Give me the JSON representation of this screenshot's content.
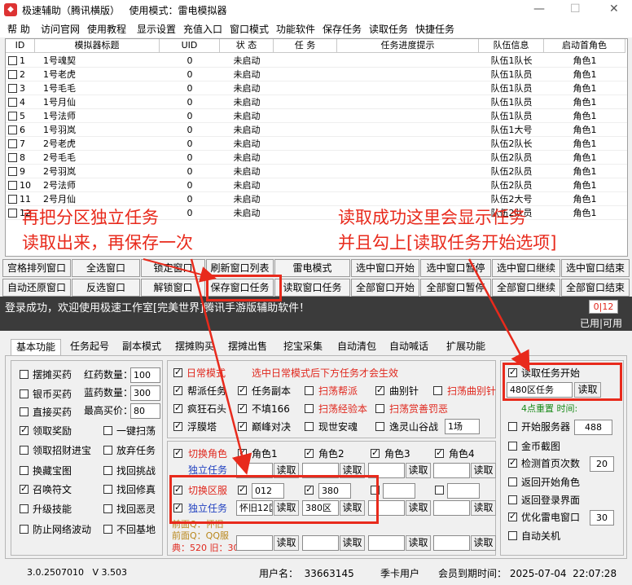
{
  "window": {
    "title": "极速辅助（腾讯横版）   使用模式：雷电模拟器",
    "minimize": "—",
    "maximize": "☐",
    "close": "✕"
  },
  "menu": [
    "帮 助",
    "访问官网",
    "使用教程",
    "显示设置",
    "充值入口",
    "窗口模式",
    "功能软件",
    "保存任务",
    "读取任务",
    "快捷任务"
  ],
  "grid": {
    "headers": [
      "ID",
      "模拟器标题",
      "UID",
      "状 态",
      "任 务",
      "任务进度提示",
      "队伍信息",
      "启动首角色"
    ],
    "rows": [
      {
        "id": "1",
        "title": "1号魂契",
        "uid": "0",
        "status": "未启动",
        "team": "队伍1队长",
        "role": "角色1"
      },
      {
        "id": "2",
        "title": "1号老虎",
        "uid": "0",
        "status": "未启动",
        "team": "队伍1队员",
        "role": "角色1"
      },
      {
        "id": "3",
        "title": "1号毛毛",
        "uid": "0",
        "status": "未启动",
        "team": "队伍1队员",
        "role": "角色1"
      },
      {
        "id": "4",
        "title": "1号月仙",
        "uid": "0",
        "status": "未启动",
        "team": "队伍1队员",
        "role": "角色1"
      },
      {
        "id": "5",
        "title": "1号法师",
        "uid": "0",
        "status": "未启动",
        "team": "队伍1队员",
        "role": "角色1"
      },
      {
        "id": "6",
        "title": "1号羽岚",
        "uid": "0",
        "status": "未启动",
        "team": "队伍1大号",
        "role": "角色1"
      },
      {
        "id": "7",
        "title": "2号老虎",
        "uid": "0",
        "status": "未启动",
        "team": "队伍2队长",
        "role": "角色1"
      },
      {
        "id": "8",
        "title": "2号毛毛",
        "uid": "0",
        "status": "未启动",
        "team": "队伍2队员",
        "role": "角色1"
      },
      {
        "id": "9",
        "title": "2号羽岚",
        "uid": "0",
        "status": "未启动",
        "team": "队伍2队员",
        "role": "角色1"
      },
      {
        "id": "10",
        "title": "2号法师",
        "uid": "0",
        "status": "未启动",
        "team": "队伍2队员",
        "role": "角色1"
      },
      {
        "id": "11",
        "title": "2号月仙",
        "uid": "0",
        "status": "未启动",
        "team": "队伍2大号",
        "role": "角色1"
      },
      {
        "id": "12",
        "title": "",
        "uid": "0",
        "status": "未启动",
        "team": "队伍2队员",
        "role": "角色1"
      }
    ]
  },
  "buttons_row1": [
    "宫格排列窗口",
    "全选窗口",
    "锁定窗口",
    "刷新窗口列表",
    "雷电模式",
    "选中窗口开始",
    "选中窗口暂停",
    "选中窗口继续",
    "选中窗口结束"
  ],
  "buttons_row2": [
    "自动还原窗口",
    "反选窗口",
    "解锁窗口",
    "保存窗口任务",
    "读取窗口任务",
    "全部窗口开始",
    "全部窗口暂停",
    "全部窗口继续",
    "全部窗口结束"
  ],
  "annotations": {
    "left1": "再把分区独立任务",
    "left2": "读取出来，再保存一次",
    "right1": "读取成功这里会显示任务",
    "right2": "并且勾上[读取任务开始选项]"
  },
  "log": {
    "message": "登录成功，欢迎使用极速工作室[完美世界]腾讯手游版辅助软件！",
    "counter": "0|12",
    "usage": "已用|可用"
  },
  "tabs": [
    "基本功能",
    "任务起号",
    "副本模式",
    "摆摊购买",
    "摆摊出售",
    "挖宝采集",
    "自动清包",
    "自动喊话",
    "扩展功能"
  ],
  "left_panel": {
    "items": [
      {
        "label": "摆摊买药",
        "checked": false
      },
      {
        "label": "银币买药",
        "checked": false
      },
      {
        "label": "直接买药",
        "checked": false
      },
      {
        "label": "领取奖励",
        "checked": true
      },
      {
        "label": "领取招财进宝",
        "checked": false
      },
      {
        "label": "换藏宝图",
        "checked": false
      },
      {
        "label": "召唤符文",
        "checked": true
      },
      {
        "label": "升级技能",
        "checked": false
      },
      {
        "label": "防止网络波动",
        "checked": false
      }
    ],
    "fields": [
      {
        "label": "红药数量：",
        "value": "100"
      },
      {
        "label": "蓝药数量：",
        "value": "300"
      },
      {
        "label": "最高买价：",
        "value": "80"
      }
    ],
    "right_items": [
      {
        "label": "一键扫荡",
        "checked": false
      },
      {
        "label": "放弃任务",
        "checked": false
      },
      {
        "label": "找回挑战",
        "checked": false
      },
      {
        "label": "找回修真",
        "checked": false
      },
      {
        "label": "找回恶灵",
        "checked": false
      },
      {
        "label": "不回基地",
        "checked": false
      }
    ]
  },
  "middle_panel": {
    "daily_mode": "日常模式",
    "hint": "选中日常模式后下方任务才会生效",
    "row1": [
      {
        "label": "帮派任务",
        "checked": true,
        "red": false
      },
      {
        "label": "任务副本",
        "checked": true,
        "red": false
      },
      {
        "label": "扫荡帮派",
        "checked": false,
        "red": true
      },
      {
        "label": "曲别针",
        "checked": true,
        "red": false
      },
      {
        "label": "扫荡曲别针",
        "checked": false,
        "red": true
      }
    ],
    "row2": [
      {
        "label": "疯狂石头",
        "checked": true,
        "red": false
      },
      {
        "label": "不填166",
        "checked": true,
        "red": false
      },
      {
        "label": "扫荡经验本",
        "checked": false,
        "red": true
      },
      {
        "label": "扫荡赏善罚恶",
        "checked": false,
        "red": true
      }
    ],
    "row3": [
      {
        "label": "浮膜塔",
        "checked": true,
        "red": false
      },
      {
        "label": "巅峰对决",
        "checked": true,
        "red": false
      },
      {
        "label": "现世安魂",
        "checked": false,
        "red": false
      },
      {
        "label": "逸灵山谷战",
        "checked": false,
        "red": false
      }
    ],
    "battle_select": "1场",
    "switch_role": "切换角色",
    "roles": [
      "角色1",
      "角色2",
      "角色3",
      "角色4"
    ],
    "independent_task": "独立任务",
    "read": "读取",
    "switch_server": "切换区服",
    "server1": "012",
    "server2": "380",
    "task_field1": "怀旧12区",
    "task_field2": "380区",
    "prev_label1": "前面Q：怀旧",
    "prev_label2": "前面Q：QQ服",
    "dian_label": "典：520  旧：30"
  },
  "right_panel": {
    "read_task_start": "读取任务开始",
    "task_file": "480区任务",
    "read": "读取",
    "tip": "4点重置 时间:",
    "items": [
      {
        "label": "开始服务器",
        "checked": false,
        "value": "488"
      },
      {
        "label": "金币截图",
        "checked": false
      },
      {
        "label": "检测首页次数",
        "checked": true,
        "value": "20"
      },
      {
        "label": "返回开始角色",
        "checked": false
      },
      {
        "label": "返回登录界面",
        "checked": false
      },
      {
        "label": "优化雷电窗口",
        "checked": true,
        "value": "30"
      },
      {
        "label": "自动关机",
        "checked": false
      }
    ]
  },
  "status": {
    "version": "3.0.2507010   V 3.503",
    "user": "用户名：  33663145",
    "type": "季卡用户",
    "expire": "会员到期时间： 2025-07-04  22:07:28"
  }
}
